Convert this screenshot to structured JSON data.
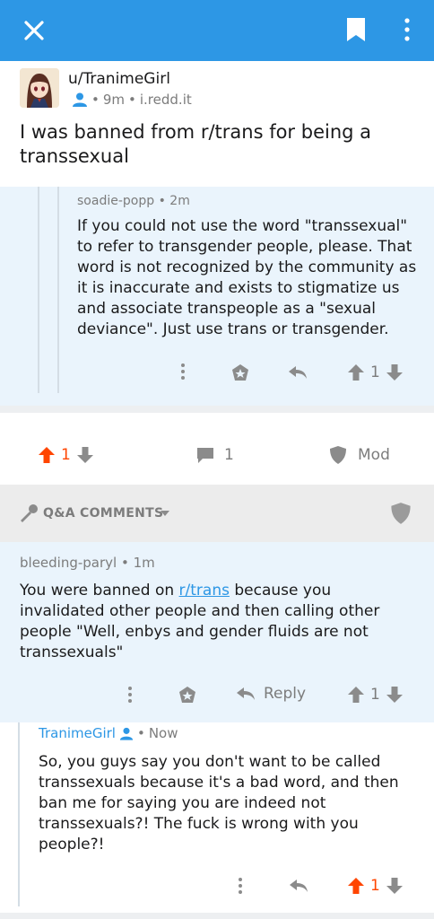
{
  "header": {
    "close_icon": "close-icon",
    "bookmark_icon": "bookmark-icon",
    "more_icon": "more-vertical-icon"
  },
  "post": {
    "author": "u/TranimeGirl",
    "age": "9m",
    "domain": "i.redd.it",
    "title": "I was banned from r/trans for being a transsexual"
  },
  "context_comment": {
    "author": "soadie-popp",
    "age": "2m",
    "body": "If you could not use the word \"transsexual\" to refer to transgender people, please. That word is not recognized by the community as it is inaccurate and exists to stigmatize us and associate transpeople as a \"sexual deviance\". Just use trans or transgender.",
    "score": "1"
  },
  "post_actions": {
    "score": "1",
    "comments": "1",
    "mod_label": "Mod"
  },
  "qa": {
    "title": "Q&A COMMENTS"
  },
  "comment1": {
    "author": "bleeding-paryl",
    "age": "1m",
    "body_before": "You were banned on ",
    "link": "r/trans",
    "body_after": " because you invalidated other people and then calling other people \"Well, enbys and gender fluids are not transsexuals\"",
    "reply_label": "Reply",
    "score": "1"
  },
  "comment2": {
    "author": "TranimeGirl",
    "age": "Now",
    "body": "So, you guys say you don't want to be called transsexuals because it's a bad word, and then ban me for saying you are indeed not transsexuals?! The fuck is wrong with you people?!",
    "score": "1"
  },
  "colors": {
    "accent": "#2d97e5",
    "upvote": "#ff4500",
    "context_bg": "#eaf4fc",
    "muted": "#7c7c7c"
  }
}
